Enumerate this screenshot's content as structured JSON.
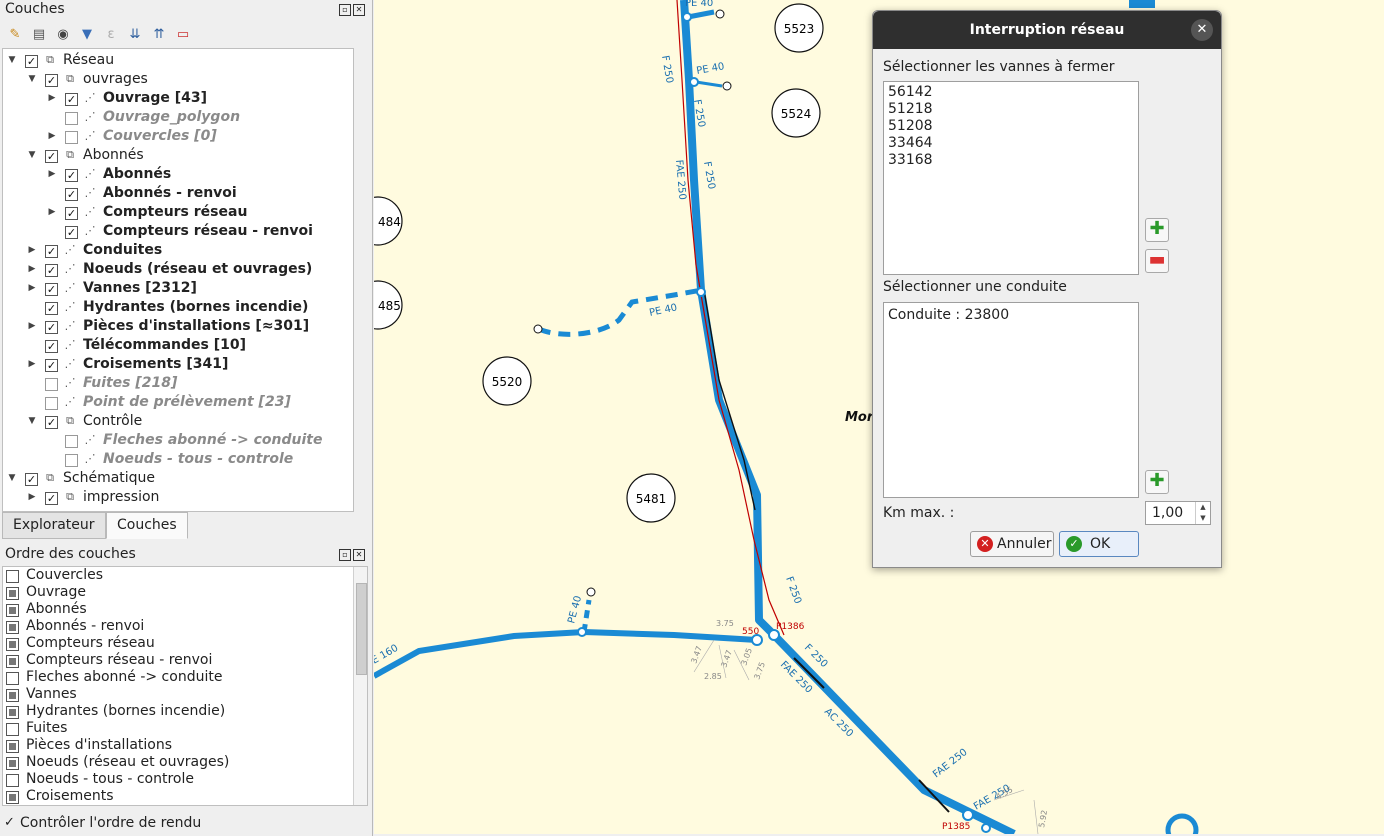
{
  "layers_panel": {
    "title": "Couches",
    "toolbar_icons": [
      "style-brush-icon",
      "add-group-icon",
      "visibility-eye-icon",
      "filter-icon",
      "filter-expression-icon",
      "expand-all-icon",
      "collapse-all-icon",
      "remove-layer-icon"
    ],
    "tree": [
      {
        "label": "Réseau",
        "checked": true,
        "style": "normal",
        "expand": "down"
      },
      {
        "label": "ouvrages",
        "checked": true,
        "style": "normal",
        "expand": "down"
      },
      {
        "label": "Ouvrage [43]",
        "checked": true,
        "style": "bold",
        "expand": "right"
      },
      {
        "label": "Ouvrage_polygon",
        "checked": false,
        "style": "gray",
        "expand": ""
      },
      {
        "label": "Couvercles [0]",
        "checked": false,
        "style": "gray",
        "expand": "right"
      },
      {
        "label": "Abonnés",
        "checked": true,
        "style": "normal",
        "expand": "down"
      },
      {
        "label": "Abonnés",
        "checked": true,
        "style": "bold",
        "expand": "right"
      },
      {
        "label": "Abonnés - renvoi",
        "checked": true,
        "style": "bold",
        "expand": ""
      },
      {
        "label": "Compteurs réseau",
        "checked": true,
        "style": "bold",
        "expand": "right"
      },
      {
        "label": "Compteurs réseau - renvoi",
        "checked": true,
        "style": "bold",
        "expand": ""
      },
      {
        "label": "Conduites",
        "checked": true,
        "style": "bold",
        "expand": "right"
      },
      {
        "label": "Noeuds (réseau et ouvrages)",
        "checked": true,
        "style": "bold",
        "expand": "right"
      },
      {
        "label": "Vannes [2312]",
        "checked": true,
        "style": "bold",
        "expand": "right"
      },
      {
        "label": "Hydrantes (bornes incendie)",
        "checked": true,
        "style": "bold",
        "expand": ""
      },
      {
        "label": "Pièces d'installations [≈301]",
        "checked": true,
        "style": "bold",
        "expand": "right"
      },
      {
        "label": "Télécommandes [10]",
        "checked": true,
        "style": "bold",
        "expand": ""
      },
      {
        "label": "Croisements [341]",
        "checked": true,
        "style": "bold",
        "expand": "right"
      },
      {
        "label": "Fuites [218]",
        "checked": false,
        "style": "gray",
        "expand": ""
      },
      {
        "label": "Point de prélèvement [23]",
        "checked": false,
        "style": "gray",
        "expand": ""
      },
      {
        "label": "Contrôle",
        "checked": true,
        "style": "normal",
        "expand": "down"
      },
      {
        "label": "Fleches abonné -> conduite",
        "checked": false,
        "style": "gray",
        "expand": ""
      },
      {
        "label": "Noeuds - tous - controle",
        "checked": false,
        "style": "gray",
        "expand": ""
      },
      {
        "label": "Schématique",
        "checked": true,
        "style": "normal",
        "expand": "down"
      },
      {
        "label": "impression",
        "checked": true,
        "style": "normal",
        "expand": "right"
      }
    ]
  },
  "tabs": [
    "Explorateur",
    "Couches"
  ],
  "order_panel": {
    "title": "Ordre des couches",
    "items": [
      {
        "label": "Couvercles",
        "checked": false
      },
      {
        "label": "Ouvrage",
        "checked": true
      },
      {
        "label": "Abonnés",
        "checked": true
      },
      {
        "label": "Abonnés - renvoi",
        "checked": true
      },
      {
        "label": "Compteurs réseau",
        "checked": true
      },
      {
        "label": "Compteurs réseau - renvoi",
        "checked": true
      },
      {
        "label": "Fleches abonné -> conduite",
        "checked": false
      },
      {
        "label": "Vannes",
        "checked": true
      },
      {
        "label": "Hydrantes (bornes incendie)",
        "checked": true
      },
      {
        "label": "Fuites",
        "checked": false
      },
      {
        "label": "Pièces d'installations",
        "checked": true
      },
      {
        "label": "Noeuds (réseau et ouvrages)",
        "checked": true
      },
      {
        "label": "Noeuds - tous - controle",
        "checked": false
      },
      {
        "label": "Croisements",
        "checked": true
      }
    ],
    "control_order": {
      "label": "Contrôler l'ordre de rendu",
      "checked": true
    }
  },
  "map": {
    "parcels": [
      "5523",
      "5524",
      "484",
      "485",
      "5520",
      "5481"
    ],
    "pipe_labels": [
      "PE 40",
      "PE 40",
      "F 250",
      "F 250",
      "FAE 250",
      "F 250",
      "PE 40",
      "PE 40",
      "F 250",
      "F 250",
      "FAE 250",
      "AC 250",
      "FAE 250",
      "FAE 250",
      "E 160"
    ],
    "node_labels": [
      "550",
      "P1386",
      "P1385"
    ],
    "dim_labels": [
      "3.75",
      "3.47",
      "3.47",
      "3.05",
      "3.75",
      "2.85",
      "4.55",
      "5.92"
    ],
    "place_label": "Mor",
    "colors": {
      "pipe": "#1a8ad4",
      "background": "#fffbdf",
      "highlight": "#c00000"
    }
  },
  "dialog": {
    "title": "Interruption réseau",
    "valves_label": "Sélectionner les vannes à fermer",
    "valves": [
      "56142",
      "51218",
      "51208",
      "33464",
      "33168"
    ],
    "pipe_label": "Sélectionner une conduite",
    "pipes": [
      "Conduite : 23800"
    ],
    "km_label": "Km max. :",
    "km_value": "1,00",
    "cancel_label": "Annuler",
    "ok_label": "OK"
  }
}
